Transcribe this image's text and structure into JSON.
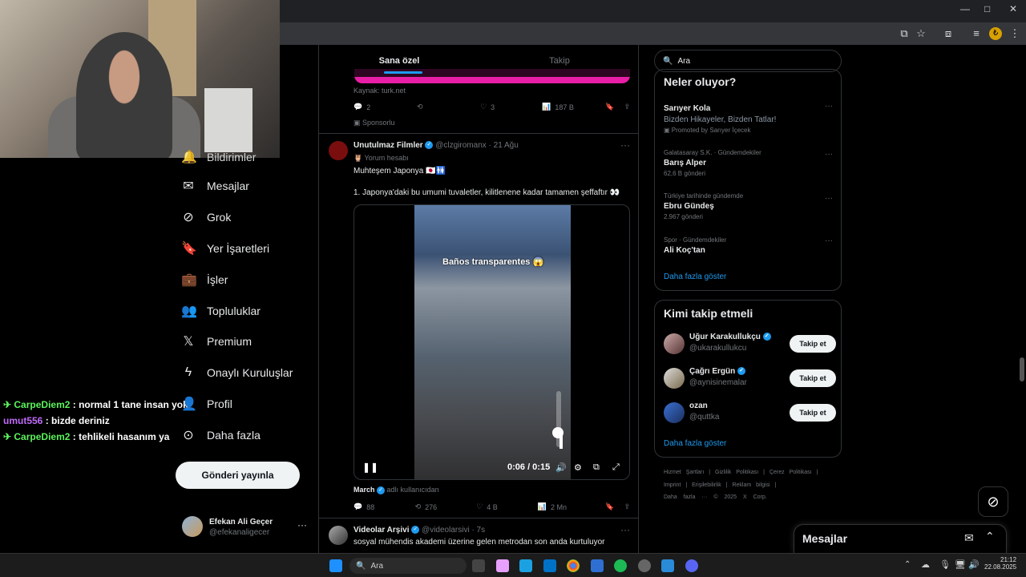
{
  "window": {
    "minimize": "—",
    "maximize": "□",
    "close": "✕"
  },
  "tabs": [
    {
      "label": "Sana özel"
    },
    {
      "label": "Takip"
    }
  ],
  "chat": [
    {
      "user": "CarpeDiem2",
      "sep": " : ",
      "text": "normal 1 tane insan yok",
      "color": "#5cf25c"
    },
    {
      "user": "umut556",
      "sep": " : ",
      "text": "bizde deriniz",
      "color": "#c06cf7"
    },
    {
      "user": "CarpeDiem2",
      "sep": " : ",
      "text": "tehlikeli hasanım ya",
      "color": "#5cf25c"
    }
  ],
  "sidebar": {
    "partial_label": "Bildirimler",
    "items": [
      {
        "label": "Mesajlar",
        "icon": "envelope-icon"
      },
      {
        "label": "Grok",
        "icon": "grok-icon"
      },
      {
        "label": "Yer İşaretleri",
        "icon": "bookmark-icon"
      },
      {
        "label": "İşler",
        "icon": "briefcase-icon"
      },
      {
        "label": "Topluluklar",
        "icon": "people-icon"
      },
      {
        "label": "Premium",
        "icon": "x-logo-icon"
      },
      {
        "label": "Onaylı Kuruluşlar",
        "icon": "lightning-icon"
      },
      {
        "label": "Profil",
        "icon": "person-icon"
      },
      {
        "label": "Daha fazla",
        "icon": "more-circle-icon"
      }
    ],
    "post_button": "Gönderi yayınla",
    "profile": {
      "name": "Efekan Ali Geçer",
      "handle": "@efekanaligecer"
    }
  },
  "ad_post": {
    "source": "Kaynak: turk.net",
    "replies": "2",
    "reposts": "",
    "likes": "3",
    "views": "187 B",
    "sponsored": "Sponsorlu"
  },
  "tweet": {
    "name": "Unutulmaz Filmler",
    "handle": "@clzgiromanx",
    "date": "· 21 Ağu",
    "note": "Yorum hesabı",
    "line1": "Muhteşem Japonya 🇯🇵🚻",
    "line2": "1. Japonya'daki bu umumi tuvaletler, kilitlenene kadar tamamen şeffaftır 👀",
    "video_caption": "Baños transparentes 😱",
    "time": "0:06 / 0:15",
    "from_user": "March",
    "from_suffix": "adlı kullanıcıdan",
    "replies": "88",
    "reposts": "276",
    "likes": "4 B",
    "views": "2 Mn"
  },
  "next_tweet": {
    "name": "Videolar Arşivi",
    "handle": "@videolarsivi",
    "date": "· 7s",
    "text": "sosyal mühendis akademi üzerine gelen metrodan son anda kurtuluyor"
  },
  "search": {
    "placeholder": "Ara"
  },
  "trends": {
    "heading": "Neler oluyor?",
    "items": [
      {
        "meta": "",
        "title": "Sarıyer Kola",
        "sub": "Bizden Hikayeler, Bizden Tatlar!",
        "promo": "Promoted by Sarıyer İçecek"
      },
      {
        "meta": "Galatasaray S.K. · Gündemdekiler",
        "title": "Barış Alper",
        "sub": "62,6 B gönderi"
      },
      {
        "meta": "Türkiye tarihinde gündemde",
        "title": "Ebru Gündeş",
        "sub": "2.967 gönderi"
      },
      {
        "meta": "Spor · Gündemdekiler",
        "title": "Ali Koç'tan",
        "sub": ""
      }
    ],
    "more": "Daha fazla göster"
  },
  "who_to_follow": {
    "heading": "Kimi takip etmeli",
    "items": [
      {
        "name": "Uğur Karakullukçu",
        "handle": "@ukarakullukcu",
        "button": "Takip et"
      },
      {
        "name": "Çağrı Ergün",
        "handle": "@aynisinemalar",
        "button": "Takip et"
      },
      {
        "name": "ozan",
        "handle": "@quttka",
        "button": "Takip et"
      }
    ],
    "more": "Daha fazla göster"
  },
  "footer": {
    "row1": [
      "Hizmet Şartları",
      "|",
      "Gizlilik Politikası",
      "|",
      "Çerez Politikası",
      "|"
    ],
    "row2": [
      "Imprint",
      "|",
      "Erişilebilirlik",
      "|",
      "Reklam bilgisi",
      "|"
    ],
    "row3": [
      "Daha fazla ···",
      "© 2025 X Corp."
    ]
  },
  "messages_drawer": {
    "title": "Mesajlar"
  },
  "taskbar": {
    "search": "Ara",
    "time": "21:12",
    "date": "22.08.2025"
  }
}
